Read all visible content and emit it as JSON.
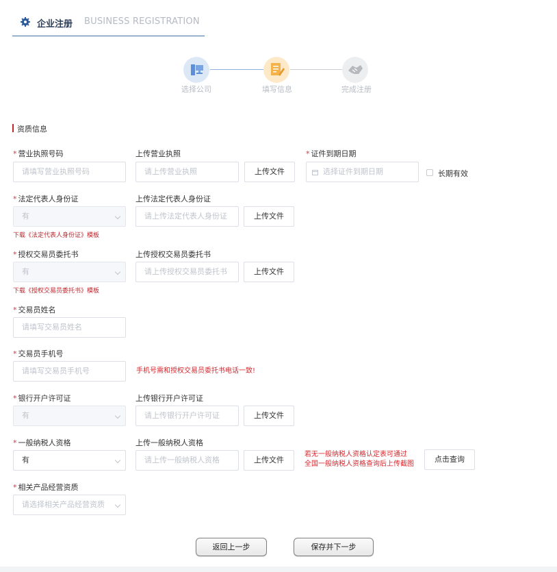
{
  "header": {
    "title": "企业注册",
    "subtitle_en": "BUSINESS REGISTRATION"
  },
  "steps": [
    {
      "label": "选择公司",
      "icon": "computer-icon",
      "color": "#7aa4df"
    },
    {
      "label": "填写信息",
      "icon": "form-edit-icon",
      "color": "#f3b24a"
    },
    {
      "label": "完成注册",
      "icon": "handshake-icon",
      "color": "#b5b8bd"
    }
  ],
  "section": {
    "title": "资质信息"
  },
  "fields": {
    "license_no": {
      "label": "营业执照号码",
      "placeholder": "请填写营业执照号码"
    },
    "license_upload": {
      "label": "上传营业执照",
      "placeholder": "请上传营业执照",
      "button": "上传文件"
    },
    "expiry": {
      "label": "证件到期日期",
      "placeholder": "选择证件到期日期",
      "long_term": "长期有效"
    },
    "legal_id": {
      "label": "法定代表人身份证",
      "value": "有",
      "note": "下载《法定代表人身份证》模板"
    },
    "legal_id_upload": {
      "label": "上传法定代表人身份证",
      "placeholder": "请上传法定代表人身份证",
      "button": "上传文件"
    },
    "auth_letter": {
      "label": "授权交易员委托书",
      "value": "有",
      "note": "下载《授权交易员委托书》模板"
    },
    "auth_letter_upload": {
      "label": "上传授权交易员委托书",
      "placeholder": "请上传授权交易员委托书",
      "button": "上传文件"
    },
    "trader_name": {
      "label": "交易员姓名",
      "placeholder": "请填写交易员姓名"
    },
    "trader_phone": {
      "label": "交易员手机号",
      "placeholder": "请填写交易员手机号",
      "warning": "手机号需和授权交易员委托书电话一致!"
    },
    "bank_permit": {
      "label": "银行开户许可证",
      "value": "有"
    },
    "bank_permit_upload": {
      "label": "上传银行开户许可证",
      "placeholder": "请上传银行开户许可证",
      "button": "上传文件"
    },
    "taxpayer": {
      "label": "一般纳税人资格",
      "value": "有"
    },
    "taxpayer_upload": {
      "label": "上传一般纳税人资格",
      "placeholder": "请上传一般纳税人资格",
      "button": "上传文件",
      "warning_line1": "若无一般纳税人资格认定表可通过",
      "warning_line2": "全国一般纳税人资格查询后上传截图",
      "query_button": "点击查询"
    },
    "product_qual": {
      "label": "相关产品经营资质",
      "placeholder": "请选择相关产品经营资质"
    }
  },
  "actions": {
    "back": "返回上一步",
    "save_next": "保存并下一步"
  },
  "colors": {
    "accent": "#3f6fa8",
    "required": "#d9363e",
    "warning": "#d9262c"
  }
}
